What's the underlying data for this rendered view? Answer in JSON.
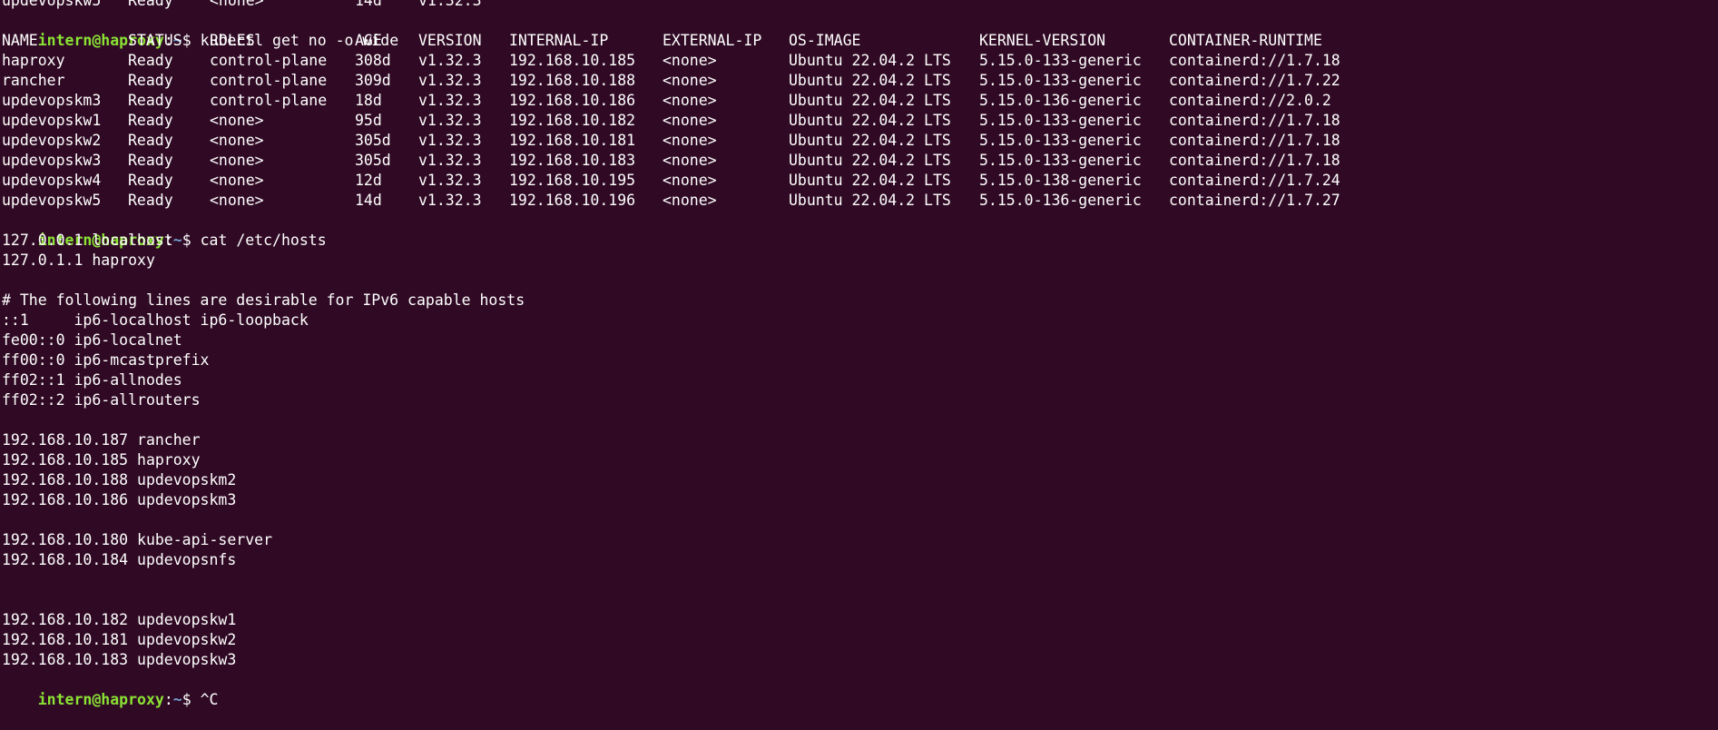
{
  "prompt": {
    "user_host": "intern@haproxy",
    "separator": ":",
    "path": "~",
    "symbol": "$ "
  },
  "partial_row": [
    "updevopskw5",
    "Ready",
    "<none>",
    "14d",
    "v1.32.3"
  ],
  "commands": {
    "kubectl": "kubectl get no -o wide",
    "cat": "cat /etc/hosts",
    "last": "^C"
  },
  "nodes_table": {
    "headers": [
      "NAME",
      "STATUS",
      "ROLES",
      "AGE",
      "VERSION",
      "INTERNAL-IP",
      "EXTERNAL-IP",
      "OS-IMAGE",
      "KERNEL-VERSION",
      "CONTAINER-RUNTIME"
    ],
    "rows": [
      [
        "haproxy",
        "Ready",
        "control-plane",
        "308d",
        "v1.32.3",
        "192.168.10.185",
        "<none>",
        "Ubuntu 22.04.2 LTS",
        "5.15.0-133-generic",
        "containerd://1.7.18"
      ],
      [
        "rancher",
        "Ready",
        "control-plane",
        "309d",
        "v1.32.3",
        "192.168.10.188",
        "<none>",
        "Ubuntu 22.04.2 LTS",
        "5.15.0-133-generic",
        "containerd://1.7.22"
      ],
      [
        "updevopskm3",
        "Ready",
        "control-plane",
        "18d",
        "v1.32.3",
        "192.168.10.186",
        "<none>",
        "Ubuntu 22.04.2 LTS",
        "5.15.0-136-generic",
        "containerd://2.0.2"
      ],
      [
        "updevopskw1",
        "Ready",
        "<none>",
        "95d",
        "v1.32.3",
        "192.168.10.182",
        "<none>",
        "Ubuntu 22.04.2 LTS",
        "5.15.0-133-generic",
        "containerd://1.7.18"
      ],
      [
        "updevopskw2",
        "Ready",
        "<none>",
        "305d",
        "v1.32.3",
        "192.168.10.181",
        "<none>",
        "Ubuntu 22.04.2 LTS",
        "5.15.0-133-generic",
        "containerd://1.7.18"
      ],
      [
        "updevopskw3",
        "Ready",
        "<none>",
        "305d",
        "v1.32.3",
        "192.168.10.183",
        "<none>",
        "Ubuntu 22.04.2 LTS",
        "5.15.0-133-generic",
        "containerd://1.7.18"
      ],
      [
        "updevopskw4",
        "Ready",
        "<none>",
        "12d",
        "v1.32.3",
        "192.168.10.195",
        "<none>",
        "Ubuntu 22.04.2 LTS",
        "5.15.0-138-generic",
        "containerd://1.7.24"
      ],
      [
        "updevopskw5",
        "Ready",
        "<none>",
        "14d",
        "v1.32.3",
        "192.168.10.196",
        "<none>",
        "Ubuntu 22.04.2 LTS",
        "5.15.0-136-generic",
        "containerd://1.7.27"
      ]
    ]
  },
  "hosts_file": [
    "127.0.0.1 localhost",
    "127.0.1.1 haproxy",
    "",
    "# The following lines are desirable for IPv6 capable hosts",
    "::1     ip6-localhost ip6-loopback",
    "fe00::0 ip6-localnet",
    "ff00::0 ip6-mcastprefix",
    "ff02::1 ip6-allnodes",
    "ff02::2 ip6-allrouters",
    "",
    "192.168.10.187 rancher",
    "192.168.10.185 haproxy",
    "192.168.10.188 updevopskm2",
    "192.168.10.186 updevopskm3",
    "",
    "192.168.10.180 kube-api-server",
    "192.168.10.184 updevopsnfs",
    "",
    "",
    "192.168.10.182 updevopskw1",
    "192.168.10.181 updevopskw2",
    "192.168.10.183 updevopskw3"
  ],
  "colors": {
    "background": "#300a24",
    "text": "#ffffff",
    "prompt_user": "#8ae234",
    "prompt_path": "#729fcf"
  }
}
